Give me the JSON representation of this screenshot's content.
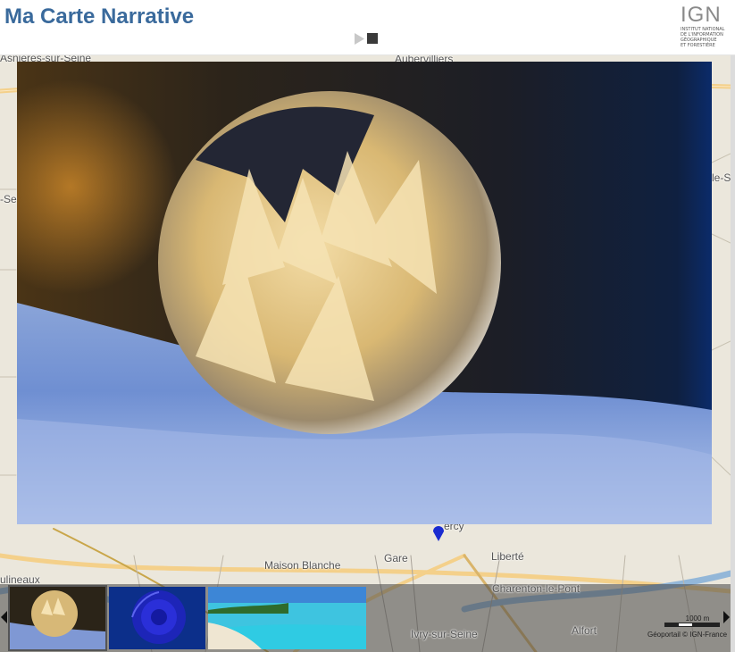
{
  "header": {
    "title": "Ma Carte Narrative",
    "logo_text": "IGN",
    "logo_subtitle_lines": [
      "Institut national",
      "de l'information",
      "géographique",
      "et forestière"
    ]
  },
  "player": {
    "play_icon": "play-icon",
    "stop_icon": "stop-icon"
  },
  "map": {
    "labels": [
      {
        "name": "label-asnieres",
        "text": "Asnières-sur-Seine"
      },
      {
        "name": "label-aubervilliers",
        "text": "Aubervilliers"
      },
      {
        "name": "label-maison-blanche",
        "text": "Maison Blanche"
      },
      {
        "name": "label-gare",
        "text": "Gare"
      },
      {
        "name": "label-liberte",
        "text": "Liberté"
      },
      {
        "name": "label-charenton",
        "text": "Charenton-le-Pont"
      },
      {
        "name": "label-moulineaux",
        "text": "ulineaux"
      },
      {
        "name": "label-ivry",
        "text": "Ivry-sur-Seine"
      },
      {
        "name": "label-alfort",
        "text": "Alfort"
      },
      {
        "name": "label-bercy",
        "text": "ercy"
      },
      {
        "name": "label-se",
        "text": "-Se"
      },
      {
        "name": "label-le-s",
        "text": "le-S"
      }
    ],
    "scale_label": "1000 m",
    "attribution": "Géoportail © IGN-France"
  },
  "thumbnails": [
    {
      "name": "thumb-frozen-bubble",
      "subject": "frozen soap bubble on snow",
      "active": true
    },
    {
      "name": "thumb-blue-rose",
      "subject": "blue rose with dew"
    },
    {
      "name": "thumb-tropical-beach",
      "subject": "tropical beach with turquoise water"
    }
  ],
  "nav": {
    "prev_icon": "chevron-left-icon",
    "next_icon": "chevron-right-icon"
  },
  "colors": {
    "title": "#3a6a9c",
    "marker": "#1a2bd0",
    "map_background": "#ebe7dc"
  }
}
